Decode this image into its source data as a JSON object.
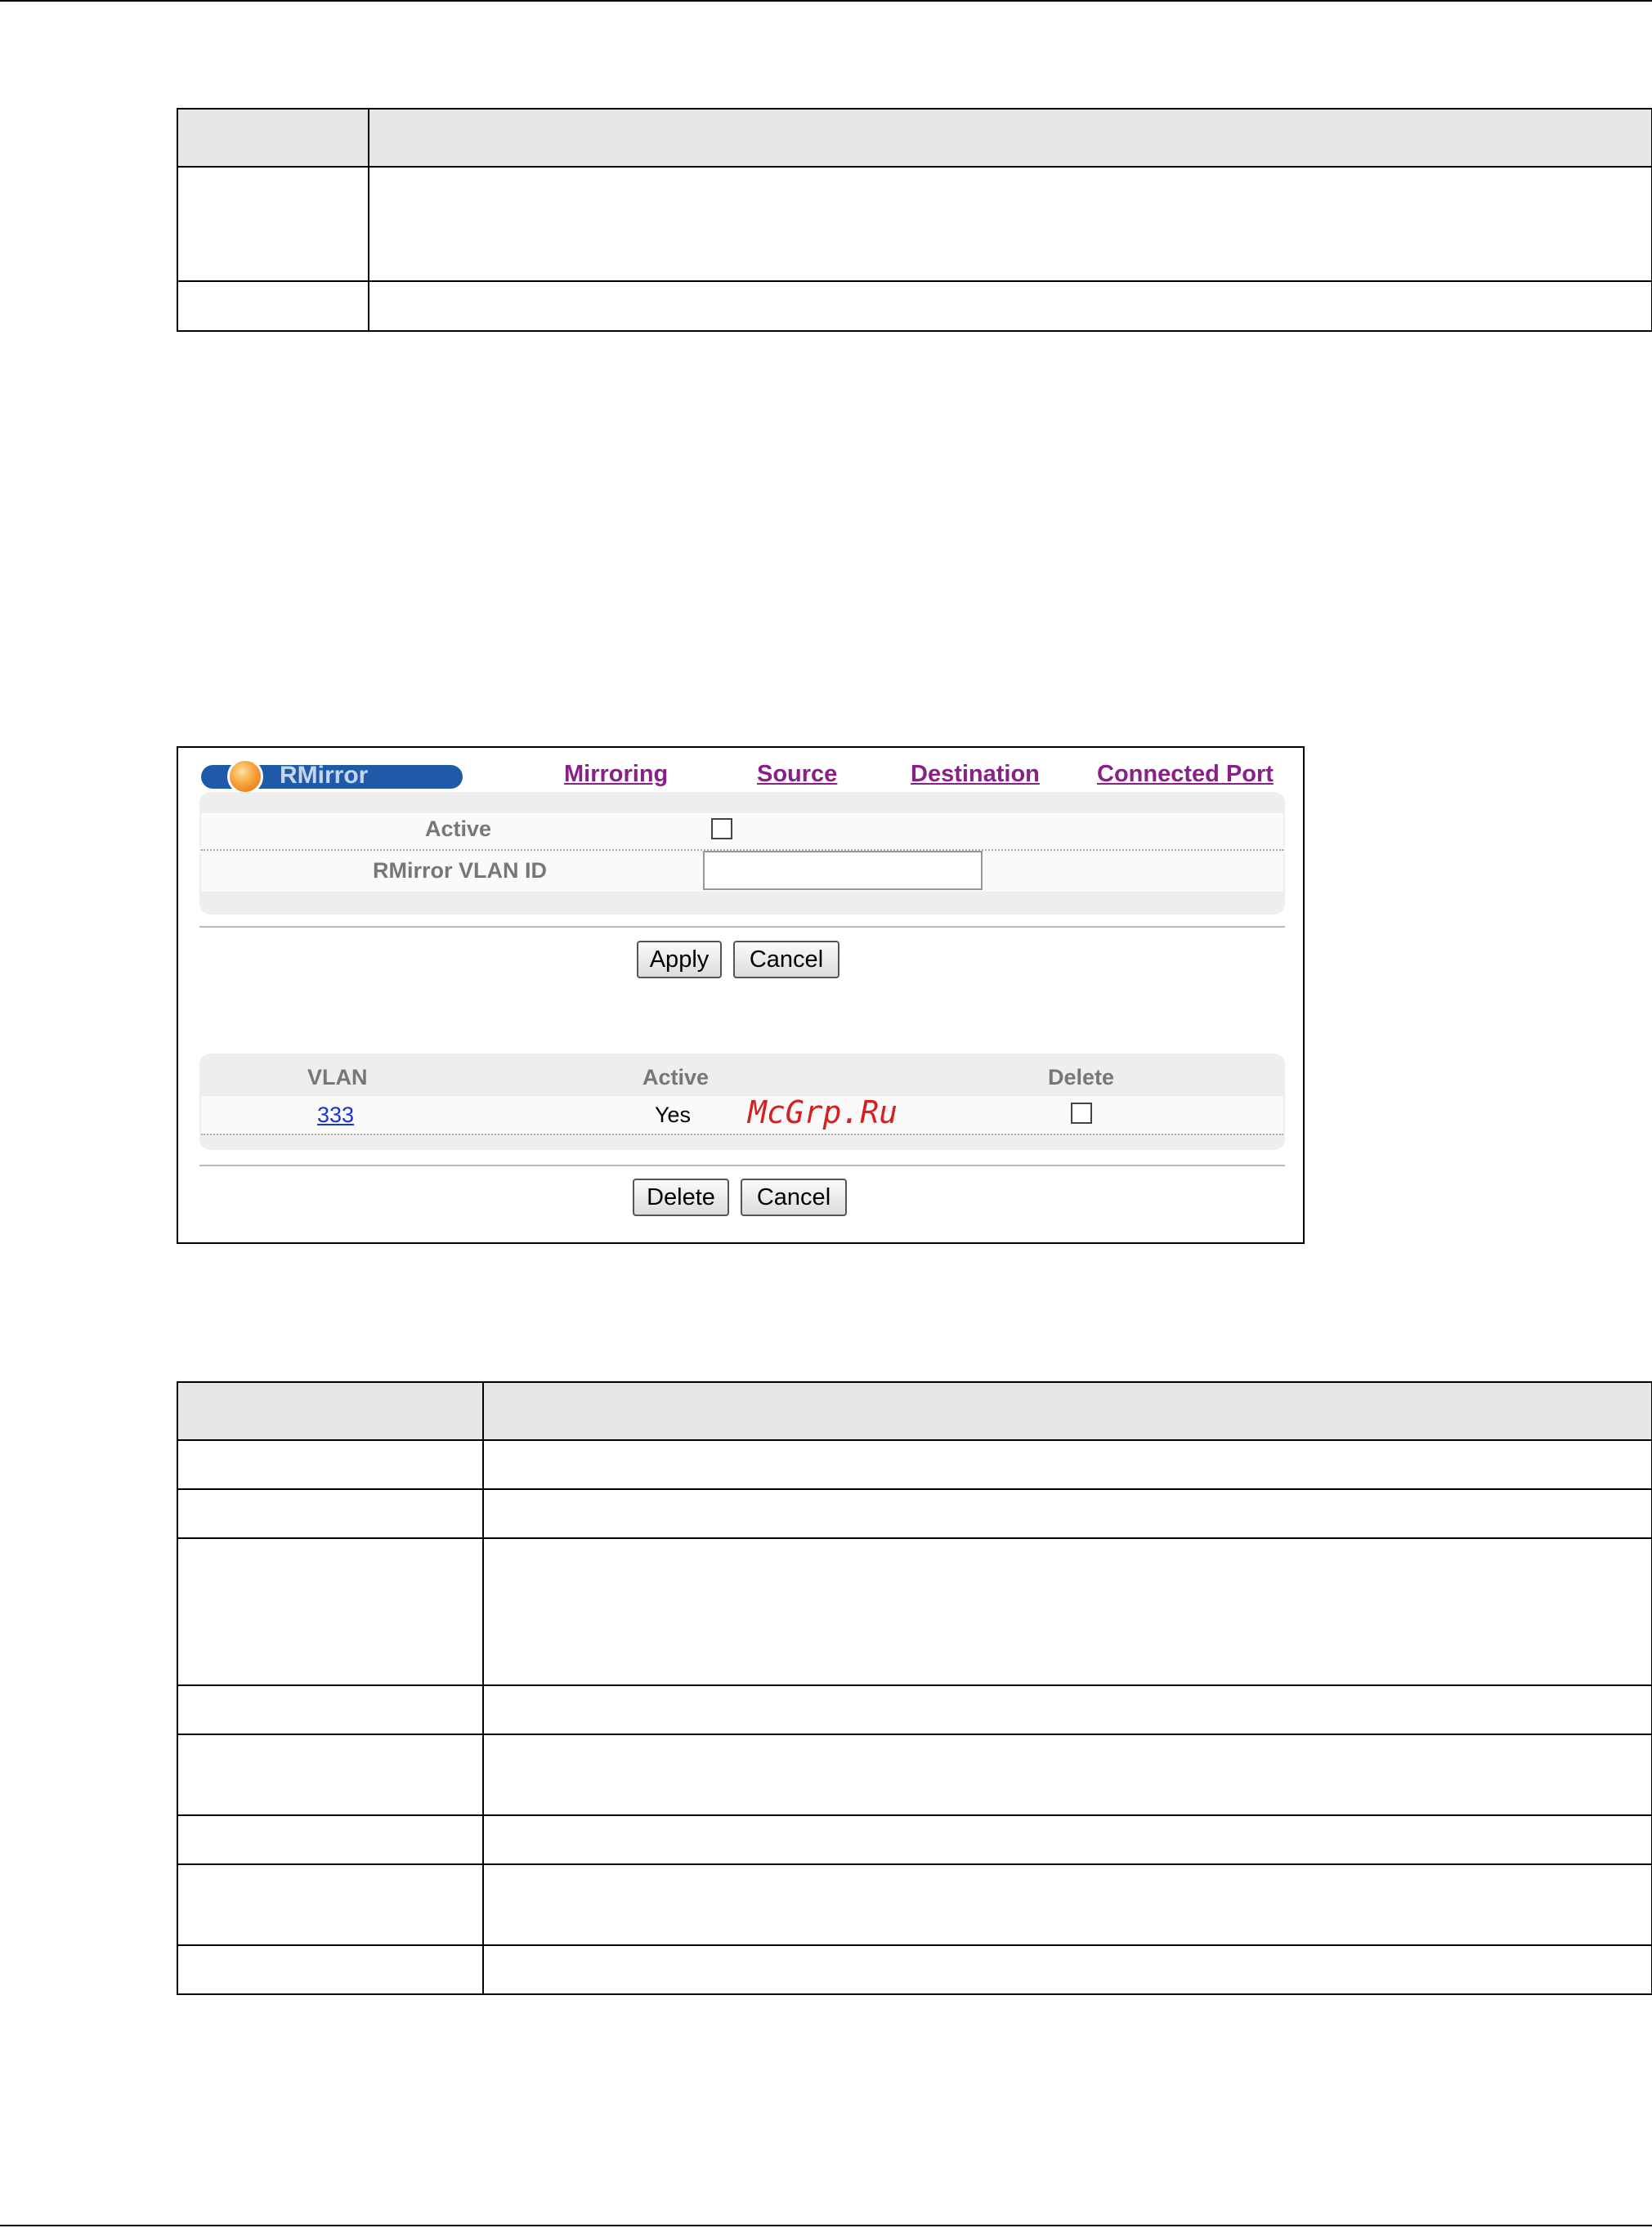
{
  "screen": {
    "title": "RMirror",
    "tabs": [
      {
        "label": "Mirroring"
      },
      {
        "label": "Source"
      },
      {
        "label": "Destination"
      },
      {
        "label": "Connected Port"
      }
    ],
    "form": {
      "active_label": "Active",
      "active_checked": false,
      "vlan_id_label": "RMirror VLAN ID",
      "vlan_id_value": ""
    },
    "buttons": {
      "apply": "Apply",
      "cancel": "Cancel",
      "delete": "Delete",
      "cancel2": "Cancel"
    },
    "list": {
      "headers": [
        "VLAN",
        "Active",
        "Delete"
      ],
      "rows": [
        {
          "vlan": "333",
          "active": "Yes",
          "delete_checked": false
        }
      ]
    },
    "watermark": "McGrp.Ru"
  },
  "colors": {
    "title_pill": "#1f5aa8",
    "tab_link": "#8a1f8a",
    "vlan_link": "#1a33d6",
    "watermark": "#d62020",
    "table_header": "#e6e6e6"
  }
}
